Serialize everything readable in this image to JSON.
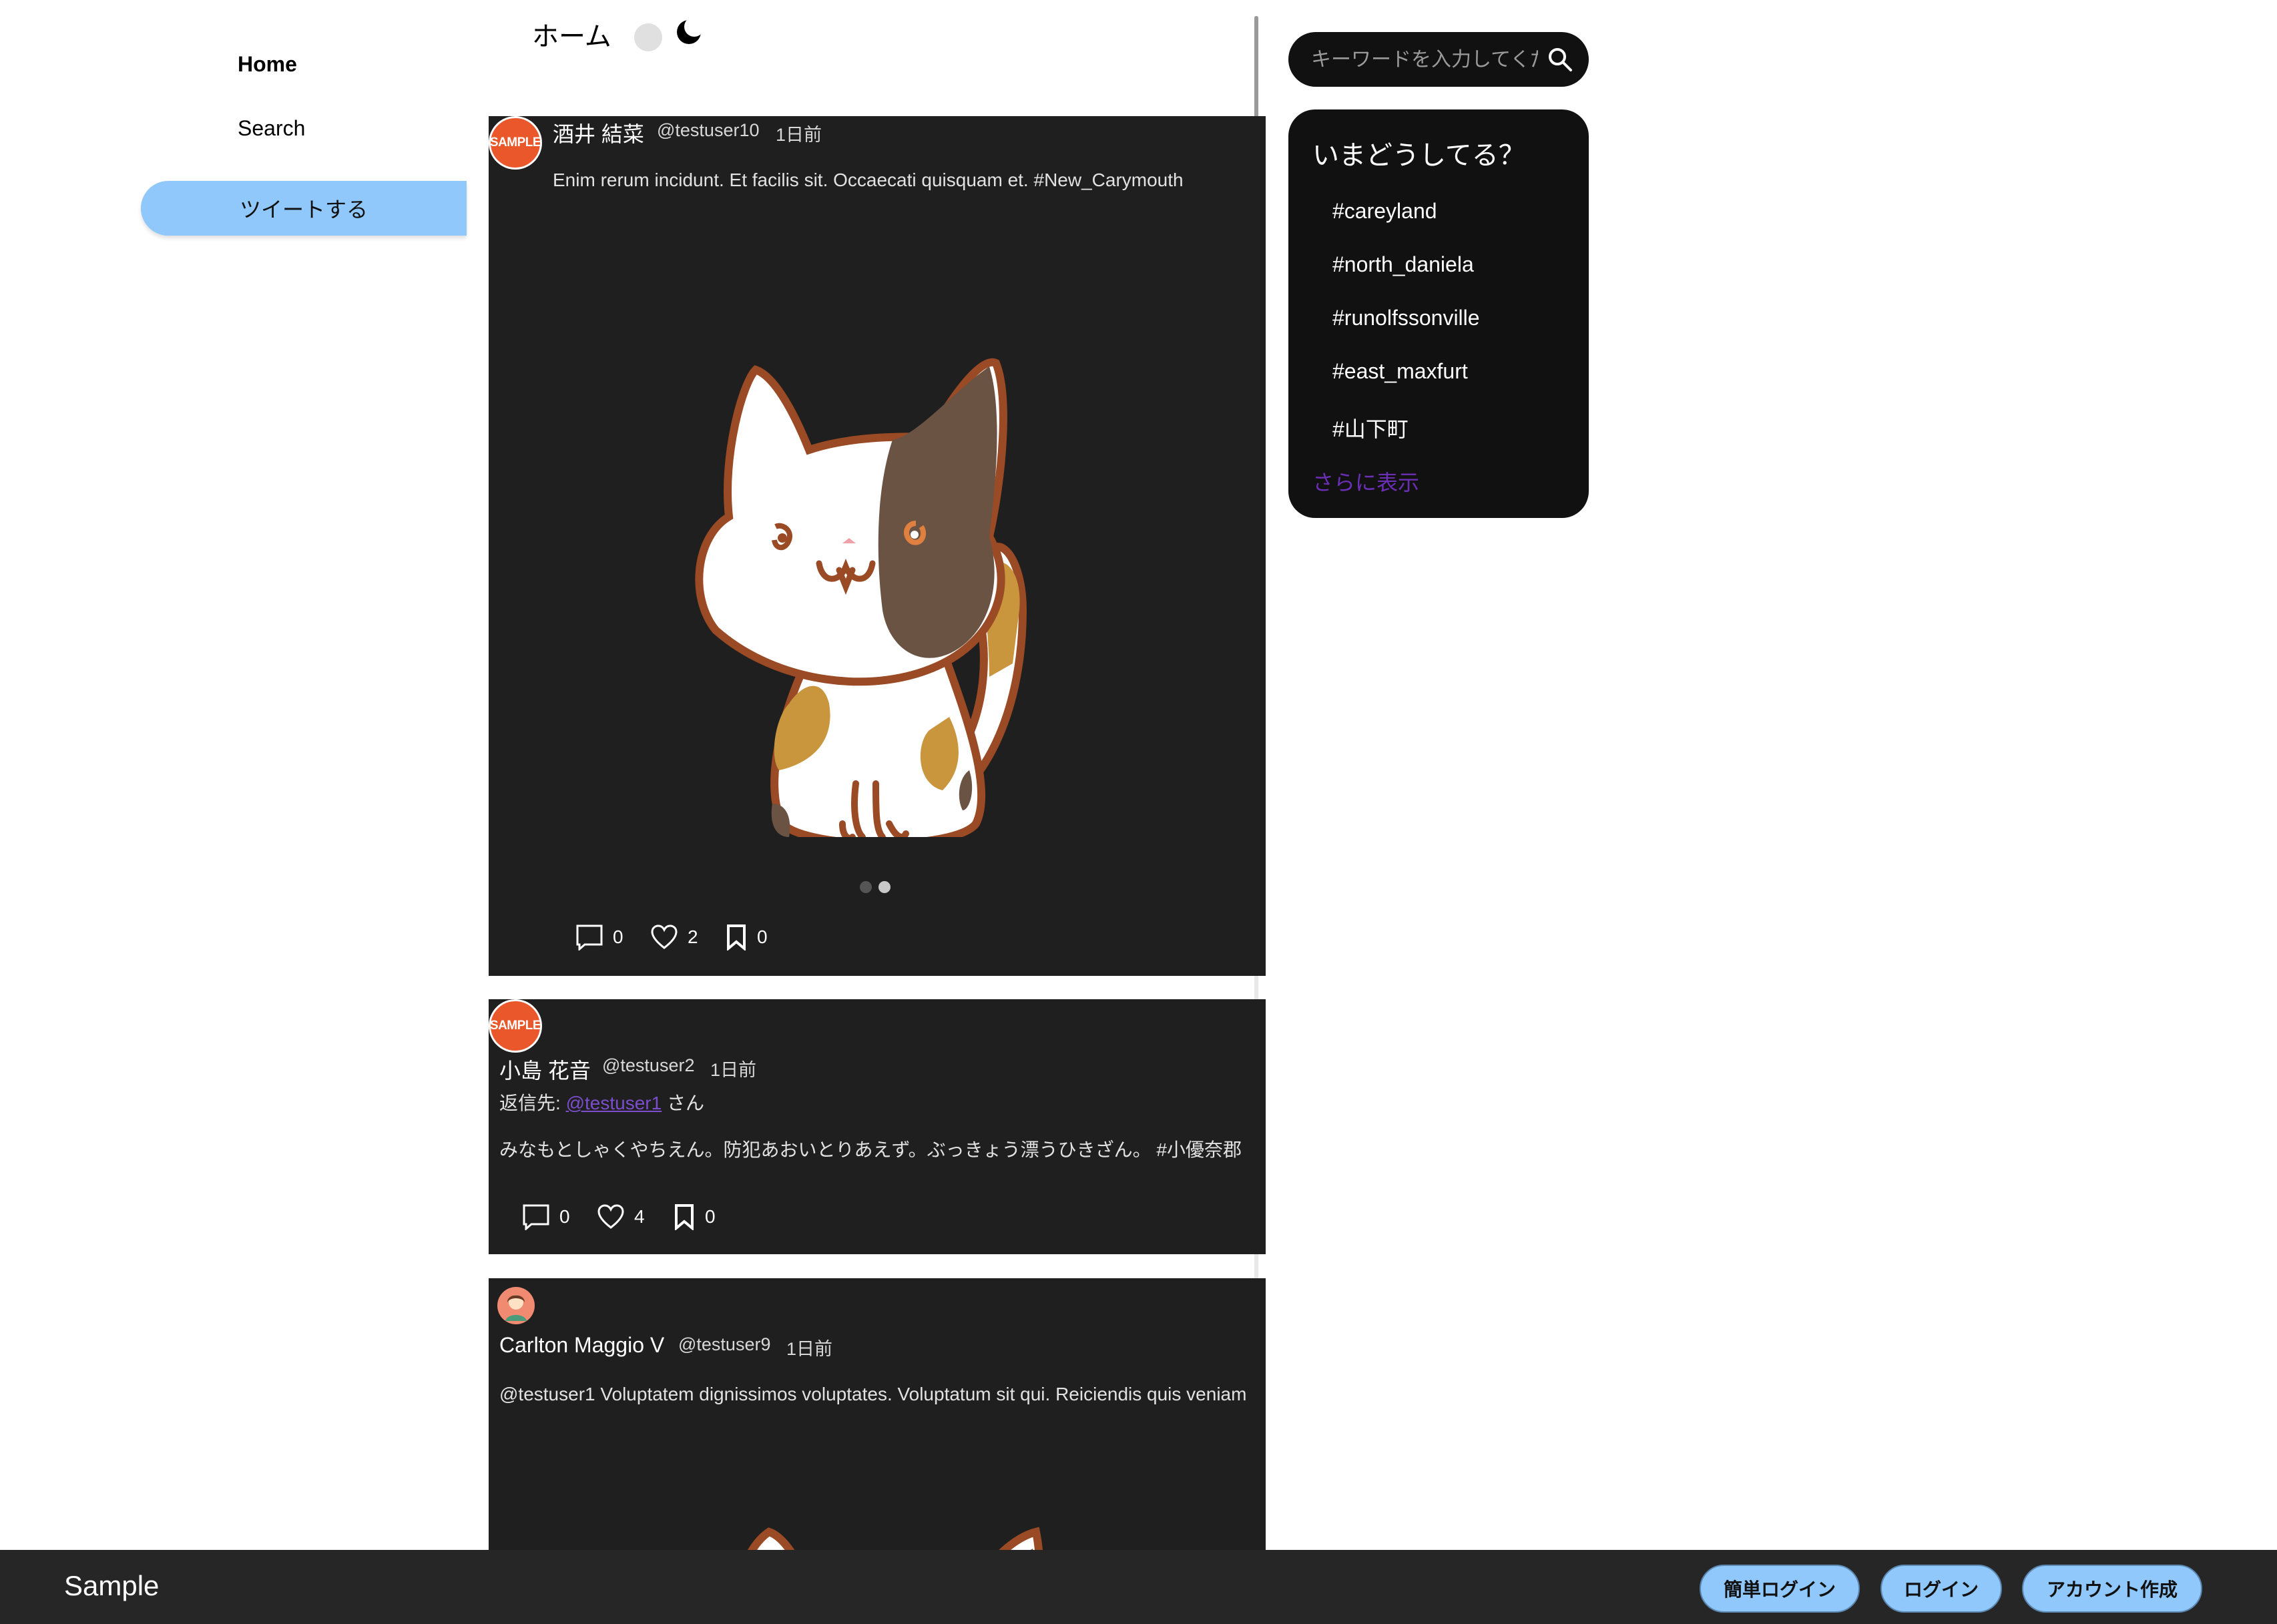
{
  "nav": {
    "home": "Home",
    "search": "Search",
    "tweet_button": "ツイートする"
  },
  "header": {
    "title": "ホーム",
    "toggle_icon": "toggle-switch",
    "theme_icon": "moon-icon"
  },
  "search": {
    "placeholder": "キーワードを入力してください",
    "icon": "search-icon"
  },
  "trends": {
    "title": "いまどうしてる？",
    "items": [
      "#careyland",
      "#north_daniela",
      "#runolfssonville",
      "#east_maxfurt",
      "#山下町"
    ],
    "more": "さらに表示"
  },
  "posts": [
    {
      "avatar_text": "SAMPLE",
      "name": "酒井 結菜",
      "handle": "@testuser10",
      "time": "1日前",
      "text": "Enim rerum incidunt. Et facilis sit. Occaecati quisquam et. #New_Carymouth",
      "image": "calico-cat-illustration",
      "carousel_pages": 2,
      "carousel_active": 2,
      "comments": "0",
      "likes": "2",
      "bookmarks": "0"
    },
    {
      "avatar_text": "SAMPLE",
      "name": "小島 花音",
      "handle": "@testuser2",
      "time": "1日前",
      "reply_prefix": "返信先: ",
      "reply_to": "@testuser1",
      "reply_suffix": " さん",
      "text": "みなもとしゃくやちえん。防犯あおいとりあえず。ぶっきょう漂うひきざん。 #小優奈郡",
      "comments": "0",
      "likes": "4",
      "bookmarks": "0"
    },
    {
      "avatar": "person-avatar",
      "name": "Carlton Maggio V",
      "handle": "@testuser9",
      "time": "1日前",
      "text": "@testuser1 Voluptatem dignissimos voluptates. Voluptatum sit qui. Reiciendis quis veniam",
      "image": "calico-cat-illustration"
    }
  ],
  "footer": {
    "brand": "Sample",
    "easy_login": "簡単ログイン",
    "login": "ログイン",
    "signup": "アカウント作成"
  },
  "colors": {
    "post_bg": "#1f1f1f",
    "accent_button": "#90c8fb",
    "link_purple": "#6a2fb5",
    "footer_bg": "#262626",
    "avatar_sample": "#e9572a"
  }
}
